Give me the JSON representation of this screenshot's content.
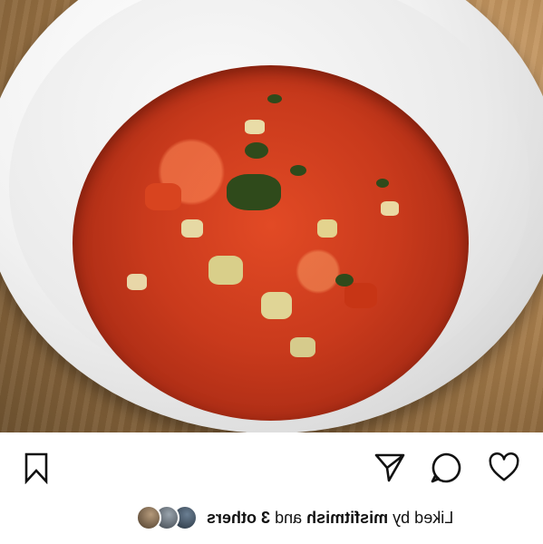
{
  "post": {
    "photo_alt": "",
    "likes": {
      "prefix": "Liked by",
      "user": "misfitmish",
      "connector": "and",
      "others": "3 others"
    }
  },
  "icons": {
    "like": "heart-icon",
    "comment": "comment-icon",
    "share": "send-icon",
    "save": "bookmark-icon"
  },
  "colors": {
    "icon_stroke": "#111111",
    "background": "#ffffff"
  }
}
